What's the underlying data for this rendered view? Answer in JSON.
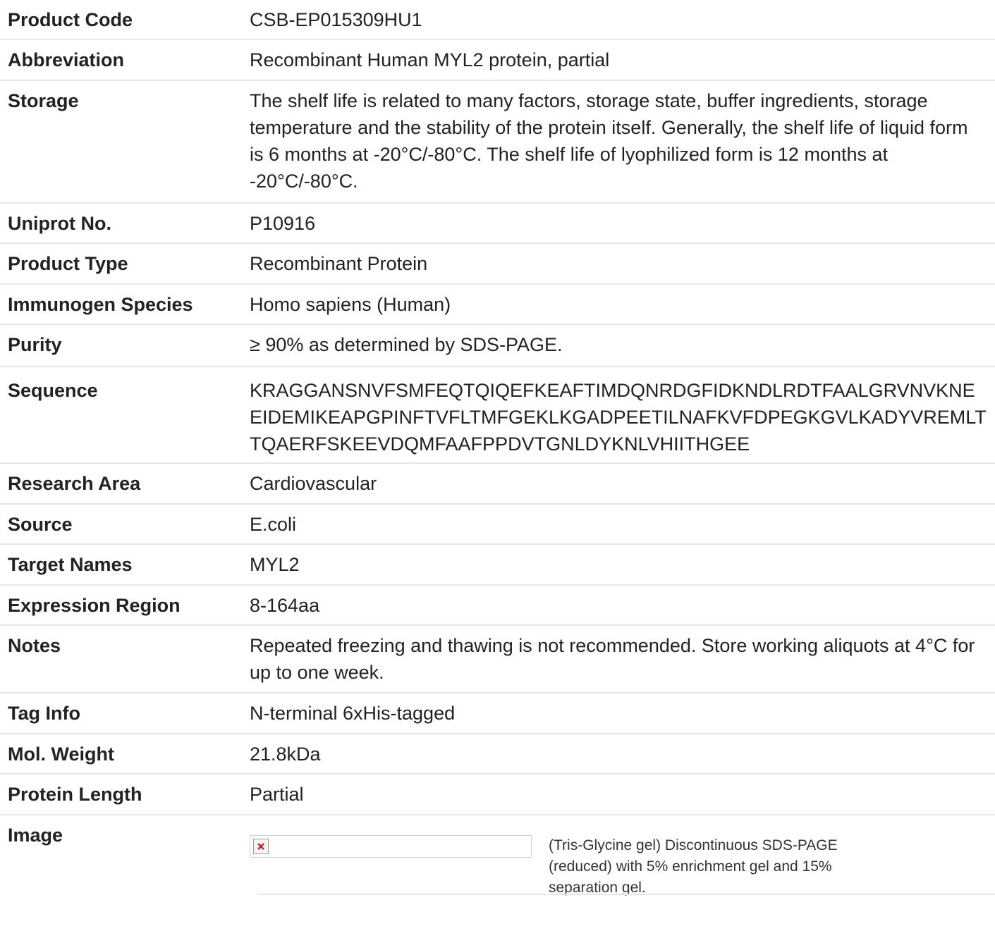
{
  "rows": [
    {
      "label": "Product Code",
      "value": "CSB-EP015309HU1"
    },
    {
      "label": "Abbreviation",
      "value": "Recombinant Human MYL2 protein, partial"
    },
    {
      "label": "Storage",
      "value": "The shelf life is related to many factors, storage state, buffer ingredients, storage temperature and the stability of the protein itself. Generally, the shelf life of liquid form is 6 months at -20°C/-80°C. The shelf life of lyophilized form is 12 months at -20°C/-80°C."
    },
    {
      "label": "Uniprot No.",
      "value": "P10916"
    },
    {
      "label": "Product Type",
      "value": "Recombinant Protein"
    },
    {
      "label": "Immunogen Species",
      "value": "Homo sapiens (Human)"
    },
    {
      "label": "Purity",
      "value": "≥ 90% as determined by SDS-PAGE."
    },
    {
      "label": "Sequence",
      "value": "KRAGGANSNVFSMFEQTQIQEFKEAFTIMDQNRDGFIDKNDLRDTFAALGRVNVKNEEIDEMIKEAPGPINFTVFLTMFGEKLKGADPEETILNAFKVFDPEGKGVLKADYVREMLTTQAERFSKEEVDQMFAAFPPDVTGNLDYKNLVHIITHGEE"
    },
    {
      "label": "Research Area",
      "value": "Cardiovascular"
    },
    {
      "label": "Source",
      "value": "E.coli"
    },
    {
      "label": "Target Names",
      "value": "MYL2"
    },
    {
      "label": "Expression Region",
      "value": "8-164aa"
    },
    {
      "label": "Notes",
      "value": "Repeated freezing and thawing is not recommended. Store working aliquots at 4°C for up to one week."
    },
    {
      "label": "Tag Info",
      "value": "N-terminal 6xHis-tagged"
    },
    {
      "label": "Mol. Weight",
      "value": "21.8kDa"
    },
    {
      "label": "Protein Length",
      "value": "Partial"
    }
  ],
  "image": {
    "label": "Image",
    "caption": "(Tris-Glycine gel) Discontinuous SDS-PAGE (reduced) with 5% enrichment gel and 15% separation gel.",
    "icon": "broken-image-icon"
  }
}
